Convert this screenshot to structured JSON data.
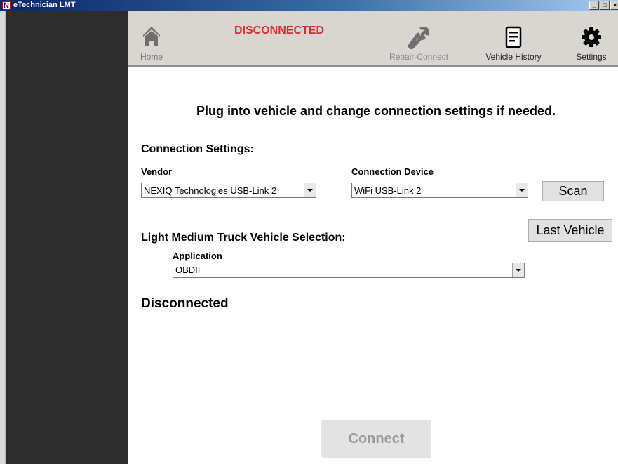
{
  "window": {
    "title": "eTechnician LMT",
    "logo_letter": "N",
    "controls": [
      "_",
      "□",
      "×"
    ]
  },
  "toolbar": {
    "status": "DISCONNECTED",
    "status_color": "#d32f2f",
    "items": [
      {
        "label": "Home",
        "icon": "home-icon"
      },
      {
        "label": "Repair-Connect",
        "icon": "wrench-icon",
        "disabled": true
      },
      {
        "label": "Vehicle History",
        "icon": "document-icon"
      },
      {
        "label": "Settings",
        "icon": "gear-icon"
      }
    ]
  },
  "main": {
    "heading": "Plug into vehicle and change connection settings if needed.",
    "connection_settings": {
      "title": "Connection Settings:",
      "vendor_label": "Vendor",
      "vendor_value": "NEXIQ Technologies USB-Link 2",
      "device_label": "Connection Device",
      "device_value": "WiFi USB-Link 2",
      "scan_label": "Scan"
    },
    "vehicle_selection": {
      "title": "Light Medium Truck Vehicle Selection:",
      "last_vehicle_label": "Last Vehicle",
      "application_label": "Application",
      "application_value": "OBDII"
    },
    "connection_status": "Disconnected",
    "connect_label": "Connect"
  }
}
